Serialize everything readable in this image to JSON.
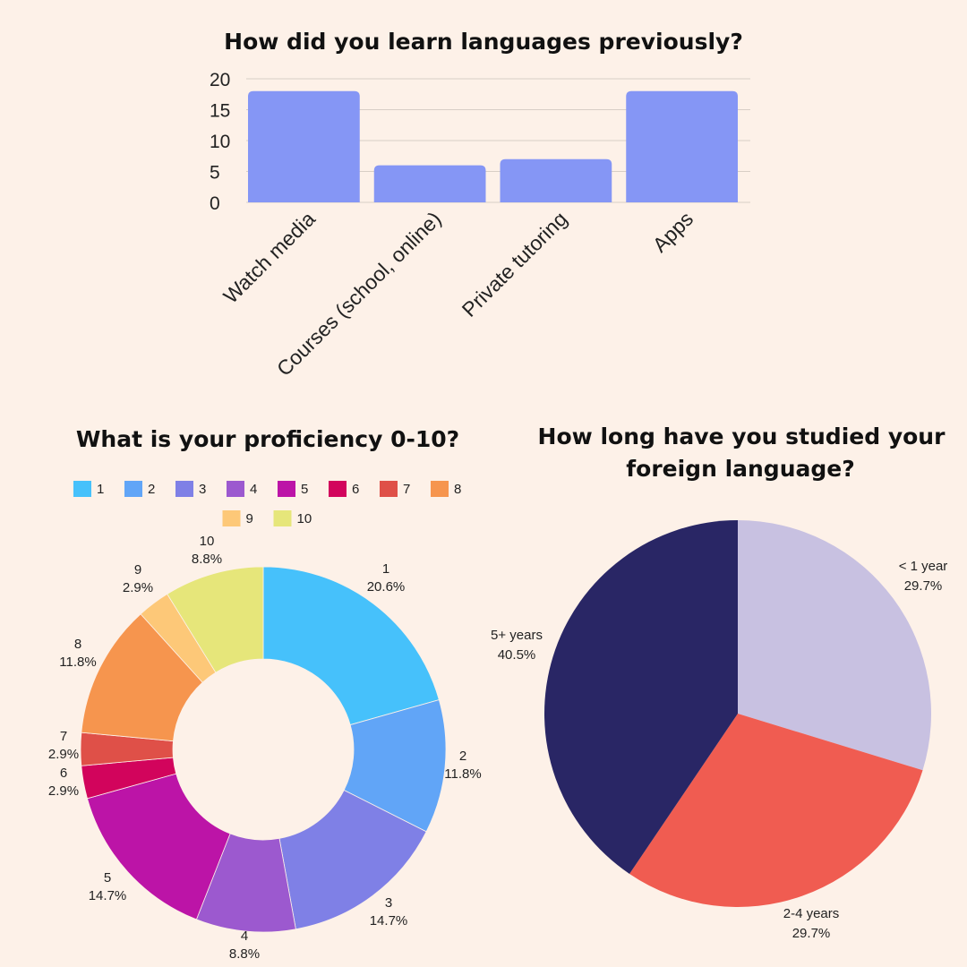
{
  "chart_data": [
    {
      "type": "bar",
      "title": "How did you learn languages previously?",
      "categories": [
        "Watch media",
        "Courses (school, online)",
        "Private tutoring",
        "Apps"
      ],
      "values": [
        18,
        6,
        7,
        18
      ],
      "ylim": [
        0,
        20
      ],
      "yticks": [
        "0",
        "5",
        "10",
        "15",
        "20"
      ],
      "grid": true,
      "bar_color": "#8596f5"
    },
    {
      "type": "pie",
      "variant": "donut",
      "title": "What is your proficiency 0-10?",
      "legend_position": "top",
      "slices": [
        {
          "label": "1",
          "percent": "20.6%",
          "value": 20.6,
          "color": "#46c1fb"
        },
        {
          "label": "2",
          "percent": "11.8%",
          "value": 11.8,
          "color": "#61a5f7"
        },
        {
          "label": "3",
          "percent": "14.7%",
          "value": 14.7,
          "color": "#7f80e6"
        },
        {
          "label": "4",
          "percent": "8.8%",
          "value": 8.8,
          "color": "#9c59cf"
        },
        {
          "label": "5",
          "percent": "14.7%",
          "value": 14.7,
          "color": "#bc14a7"
        },
        {
          "label": "6",
          "percent": "2.9%",
          "value": 2.9,
          "color": "#d2045c"
        },
        {
          "label": "7",
          "percent": "2.9%",
          "value": 2.9,
          "color": "#df5048"
        },
        {
          "label": "8",
          "percent": "11.8%",
          "value": 11.8,
          "color": "#f6954e"
        },
        {
          "label": "9",
          "percent": "2.9%",
          "value": 2.9,
          "color": "#fdc878"
        },
        {
          "label": "10",
          "percent": "8.8%",
          "value": 8.8,
          "color": "#e6e67a"
        }
      ]
    },
    {
      "type": "pie",
      "title_lines": [
        "How long have you studied your",
        "foreign language?"
      ],
      "slices": [
        {
          "label": "< 1 year",
          "percent": "29.7%",
          "value": 29.7,
          "color": "#c8c1e1"
        },
        {
          "label": "2-4 years",
          "percent": "29.7%",
          "value": 29.7,
          "color": "#f05c51"
        },
        {
          "label": "5+ years",
          "percent": "40.5%",
          "value": 40.5,
          "color": "#292665"
        }
      ]
    }
  ]
}
